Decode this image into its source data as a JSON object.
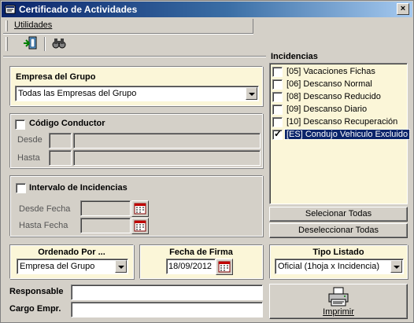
{
  "window": {
    "title": "Certificado de Actividades",
    "close_glyph": "×"
  },
  "menu": {
    "utilidades": "Utilidades"
  },
  "toolbar": {
    "exit_icon": "exit-door-icon",
    "search_icon": "binoculars-icon"
  },
  "empresa": {
    "label": "Empresa del Grupo",
    "selected": "Todas las Empresas del Grupo"
  },
  "conductor": {
    "label": "Código Conductor",
    "checked": false,
    "desde": "Desde",
    "hasta": "Hasta"
  },
  "intervalo": {
    "label": "Intervalo de Incidencias",
    "checked": false,
    "desde_fecha": "Desde Fecha",
    "hasta_fecha": "Hasta Fecha"
  },
  "ordenado": {
    "label": "Ordenado Por ...",
    "selected": "Empresa del Grupo"
  },
  "firma": {
    "label": "Fecha de Firma",
    "value": "18/09/2012"
  },
  "tipo": {
    "label": "Tipo Listado",
    "selected": "Oficial (1hoja x Incidencia)"
  },
  "responsable": {
    "label": "Responsable",
    "value": ""
  },
  "cargo": {
    "label": "Cargo Empr.",
    "value": ""
  },
  "incidencias": {
    "label": "Incidencias",
    "items": [
      {
        "text": "[05] Vacaciones Fichas",
        "checked": false
      },
      {
        "text": "[06] Descanso Normal",
        "checked": false
      },
      {
        "text": "[08] Descanso Reducido",
        "checked": false
      },
      {
        "text": "[09] Descanso Diario",
        "checked": false
      },
      {
        "text": "[10] Descanso Recuperación",
        "checked": false
      },
      {
        "text": "[ES] Condujo Vehiculo Excluido",
        "checked": true
      }
    ]
  },
  "buttons": {
    "select_all": "Selecionar Todas",
    "deselect_all": "Deseleccionar Todas",
    "print": "Imprimir"
  },
  "colors": {
    "panel_bg": "#fbf6d8",
    "title_bar": "#0a246a",
    "face": "#d4d0c8"
  }
}
